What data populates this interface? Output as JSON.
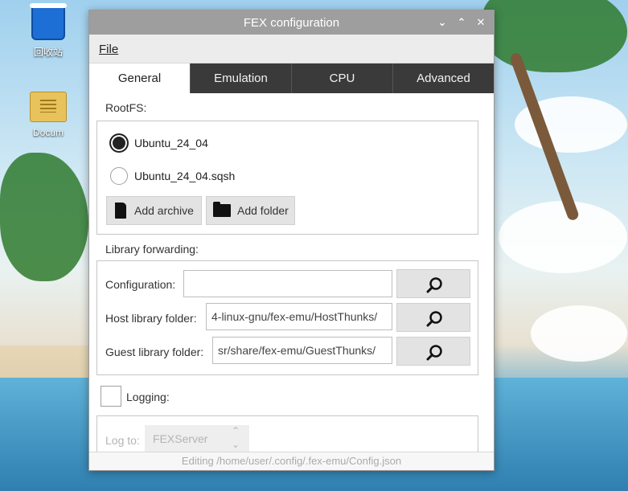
{
  "desktop": {
    "icons": [
      {
        "label": "回收站",
        "icon": "trash-icon"
      },
      {
        "label": "Docum",
        "icon": "folder-icon"
      }
    ]
  },
  "window": {
    "title": "FEX configuration",
    "controls": [
      "minimize",
      "maximize",
      "close"
    ],
    "menu": {
      "file_label": "File"
    },
    "tabs": [
      {
        "label": "General",
        "active": true
      },
      {
        "label": "Emulation",
        "active": false
      },
      {
        "label": "CPU",
        "active": false
      },
      {
        "label": "Advanced",
        "active": false
      }
    ],
    "rootfs": {
      "label": "RootFS:",
      "options": [
        {
          "label": "Ubuntu_24_04",
          "checked": true
        },
        {
          "label": "Ubuntu_24_04.sqsh",
          "checked": false
        }
      ],
      "add_archive": "Add archive",
      "add_folder": "Add folder"
    },
    "library_forwarding": {
      "label": "Library forwarding:",
      "configuration_label": "Configuration:",
      "configuration_value": "",
      "host_label": "Host library folder:",
      "host_value": "4-linux-gnu/fex-emu/HostThunks/",
      "guest_label": "Guest library folder:",
      "guest_value": "sr/share/fex-emu/GuestThunks/"
    },
    "logging": {
      "label": "Logging:",
      "checked": false,
      "log_to_label": "Log to:",
      "log_to_value": "FEXServer"
    },
    "status": "Editing /home/user/.config/.fex-emu/Config.json"
  }
}
